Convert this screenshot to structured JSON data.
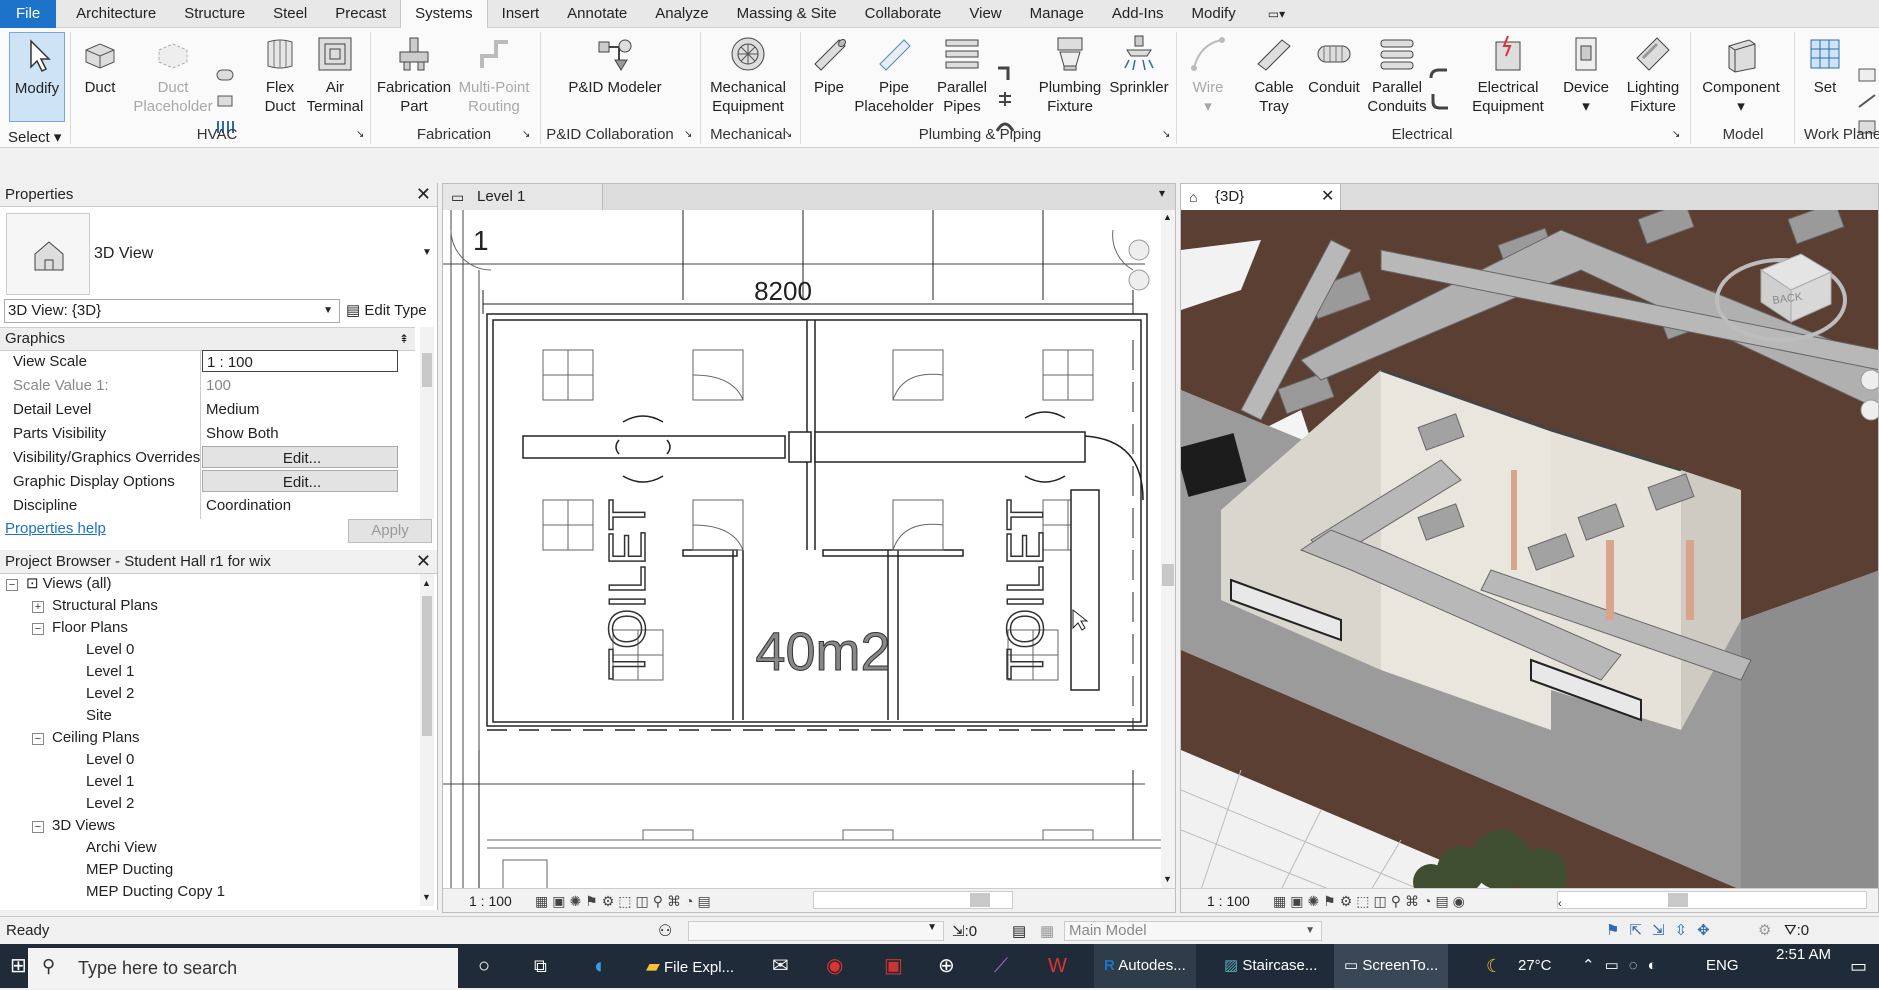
{
  "menu": {
    "file": "File",
    "tabs": [
      "Architecture",
      "Structure",
      "Steel",
      "Precast",
      "Systems",
      "Insert",
      "Annotate",
      "Analyze",
      "Massing & Site",
      "Collaborate",
      "View",
      "Manage",
      "Add-Ins",
      "Modify"
    ],
    "active_tab": "Systems"
  },
  "ribbon": {
    "modify": "Modify",
    "select": "Select",
    "duct": "Duct",
    "duct_placeholder_1": "Duct",
    "duct_placeholder_2": "Placeholder",
    "flex_duct_1": "Flex",
    "flex_duct_2": "Duct",
    "air_terminal_1": "Air",
    "air_terminal_2": "Terminal",
    "fabrication_part_1": "Fabrication",
    "fabrication_part_2": "Part",
    "multi_point_1": "Multi-Point",
    "multi_point_2": "Routing",
    "pid_modeler": "P&ID Modeler",
    "mech_equip_1": "Mechanical",
    "mech_equip_2": "Equipment",
    "pipe": "Pipe",
    "pipe_placeholder_1": "Pipe",
    "pipe_placeholder_2": "Placeholder",
    "parallel_pipes_1": "Parallel",
    "parallel_pipes_2": "Pipes",
    "plumbing_fixture_1": "Plumbing",
    "plumbing_fixture_2": "Fixture",
    "sprinkler": "Sprinkler",
    "wire": "Wire",
    "cable_tray_1": "Cable",
    "cable_tray_2": "Tray",
    "conduit": "Conduit",
    "parallel_conduits_1": "Parallel",
    "parallel_conduits_2": "Conduits",
    "elec_equip_1": "Electrical",
    "elec_equip_2": "Equipment",
    "device": "Device",
    "lighting_fixture_1": "Lighting",
    "lighting_fixture_2": "Fixture",
    "component": "Component",
    "set": "Set",
    "panels": {
      "hvac": "HVAC",
      "fabrication": "Fabrication",
      "pid": "P&ID Collaboration",
      "mechanical": "Mechanical",
      "plumbing": "Plumbing & Piping",
      "electrical": "Electrical",
      "model": "Model",
      "work_plane": "Work Plane"
    }
  },
  "properties": {
    "title": "Properties",
    "type_name": "3D View",
    "instance_selector": "3D View: {3D}",
    "edit_type": "Edit Type",
    "group": "Graphics",
    "rows": [
      {
        "key": "View Scale",
        "value": "1 : 100"
      },
      {
        "key": "Scale Value    1:",
        "value": "100"
      },
      {
        "key": "Detail Level",
        "value": "Medium"
      },
      {
        "key": "Parts Visibility",
        "value": "Show Both"
      },
      {
        "key": "Visibility/Graphics Overrides",
        "value": "Edit..."
      },
      {
        "key": "Graphic Display Options",
        "value": "Edit..."
      },
      {
        "key": "Discipline",
        "value": "Coordination"
      }
    ],
    "help": "Properties help",
    "apply": "Apply"
  },
  "browser": {
    "title": "Project Browser - Student Hall r1 for wix",
    "views_all": "Views (all)",
    "structural_plans": "Structural Plans",
    "floor_plans": "Floor Plans",
    "fp_level0": "Level 0",
    "fp_level1": "Level 1",
    "fp_level2": "Level 2",
    "fp_site": "Site",
    "ceiling_plans": "Ceiling Plans",
    "cp_level0": "Level 0",
    "cp_level1": "Level 1",
    "cp_level2": "Level 2",
    "views_3d": "3D Views",
    "archi_view": "Archi View",
    "mep_ducting": "MEP Ducting",
    "mep_ducting_copy": "MEP Ducting Copy 1"
  },
  "plan_view": {
    "tab": "Level 1",
    "dimension": "8200",
    "room_left": "TOILET",
    "room_right": "TOILET",
    "area": "40m2",
    "grid_bubble": "1",
    "scale": "1 : 100"
  },
  "view_3d": {
    "tab": "{3D}",
    "scale": "1 : 100",
    "viewcube": "BACK"
  },
  "status": {
    "ready": "Ready",
    "sel_count": ":0",
    "model": "Main Model",
    "filter_count": ":0"
  },
  "taskbar": {
    "search": "Type here to search",
    "file_explorer": "File Expl...",
    "autodesk": "Autodes...",
    "staircase": "Staircase...",
    "screento": "ScreenTo...",
    "temp": "27°C",
    "lang": "ENG",
    "time": "2:51 AM"
  }
}
